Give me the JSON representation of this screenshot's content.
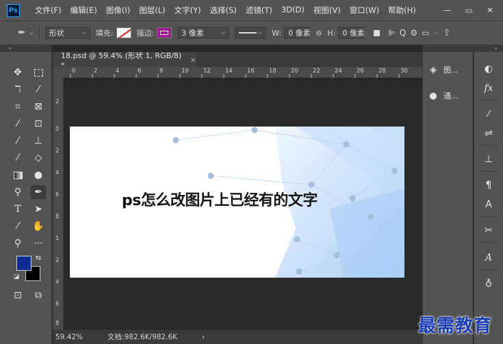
{
  "app": {
    "logo": "Ps"
  },
  "menu": [
    "文件(F)",
    "编辑(E)",
    "图像(I)",
    "图层(L)",
    "文字(Y)",
    "选择(S)",
    "滤镜(T)",
    "3D(D)",
    "视图(V)",
    "窗口(W)",
    "帮助(H)"
  ],
  "window_controls": {
    "minimize": "—",
    "restore": "▭",
    "close": "✕"
  },
  "options": {
    "tool_mode": "形状",
    "fill_label": "填充:",
    "stroke_label": "描边:",
    "stroke_width": "3 像素",
    "w_label": "W:",
    "w_value": "0 像素",
    "h_label": "H:",
    "h_value": "0 像素",
    "link_icon": "⊖"
  },
  "document": {
    "tab_title": "18.psd @ 59.4% (形状 1, RGB/8) *",
    "tab_close": "×",
    "ruler_top_labels": [
      "0",
      "2",
      "4",
      "6",
      "8",
      "10",
      "12",
      "14",
      "16",
      "18",
      "20",
      "22",
      "24",
      "26",
      "28",
      "30"
    ],
    "ruler_left_labels": [
      "2",
      "0",
      "2",
      "4",
      "6",
      "8",
      "1",
      "2",
      "4",
      "6",
      "8"
    ],
    "image_text": "ps怎么改图片上已经有的文字"
  },
  "status": {
    "zoom": "59.42%",
    "doc_size": "文档:982.6K/982.6K",
    "arrow": "›"
  },
  "panels": [
    {
      "name": "layers",
      "label": "图..."
    },
    {
      "name": "channels",
      "label": "通..."
    }
  ],
  "watermark": "最需教育",
  "colors": {
    "foreground": "#0a2d8f",
    "background": "#000000",
    "stroke": "#9c1a8e",
    "accent": "#31a8ff"
  }
}
